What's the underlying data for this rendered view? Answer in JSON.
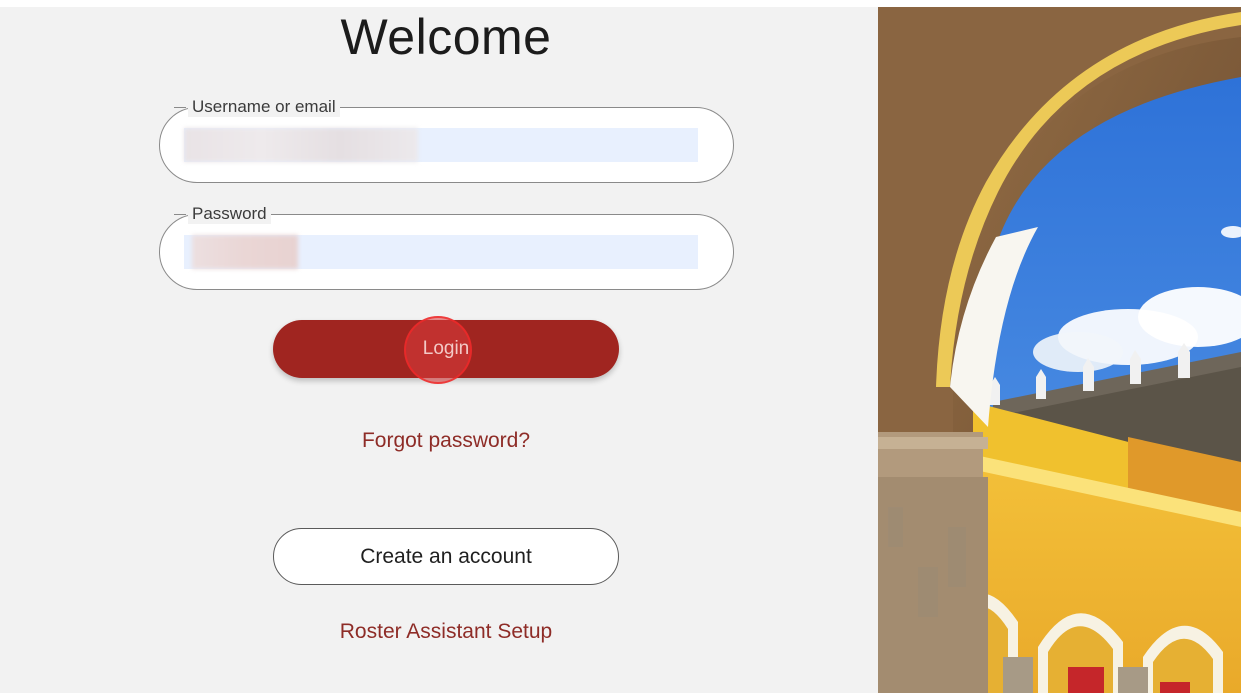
{
  "login_form": {
    "title": "Welcome",
    "username": {
      "label": "Username or email",
      "value": ""
    },
    "password": {
      "label": "Password",
      "value": ""
    },
    "login_label": "Login",
    "forgot_label": "Forgot password?",
    "create_account_label": "Create an account",
    "roster_setup_label": "Roster Assistant Setup"
  },
  "colors": {
    "primary": "#a02520",
    "link": "#8e2c27",
    "panel_bg": "#f2f2f2",
    "autofill_bg": "#e8f0fe"
  },
  "hero_image": {
    "icon": "photo-archway-yellow-convent"
  }
}
